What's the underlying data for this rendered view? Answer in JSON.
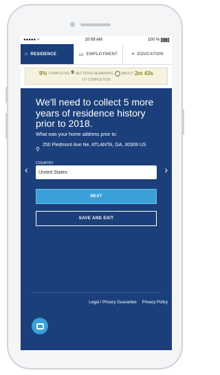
{
  "status_bar": {
    "signal": "●●●●● ",
    "time": "10:09 AM",
    "battery": "100 %"
  },
  "tabs": [
    {
      "label": "RESIDENCE",
      "icon": "house-icon"
    },
    {
      "label": "EMPLOYMENT",
      "icon": "briefcase-icon"
    },
    {
      "label": "EDUCATION",
      "icon": "graduation-cap-icon"
    }
  ],
  "progress": {
    "percent": "9%",
    "completed_label": "COMPLETED",
    "sections_remaining": "9",
    "sections_label": "SECTIONS REMAINING",
    "about_label": "ABOUT",
    "time_left": "2m 43s",
    "to_completion": "TO COMPLETION"
  },
  "main": {
    "headline": "We'll need to collect 5 more years of residence history prior to 2018.",
    "question": "What was your home address prior to:",
    "address": "250 Piedmont Ave Ne, ATLANTA, GA, 30309 US",
    "country_label": "COUNTRY",
    "country_value": "United States",
    "next_button": "NEXT",
    "save_button": "SAVE AND EXIT"
  },
  "footer": {
    "legal_link": "Legal / Privacy Guarantee",
    "privacy_link": "Privacy Policy"
  },
  "colors": {
    "primary": "#1b3f7a",
    "accent": "#3aa0d8",
    "progress_bg": "#f5f2df"
  }
}
